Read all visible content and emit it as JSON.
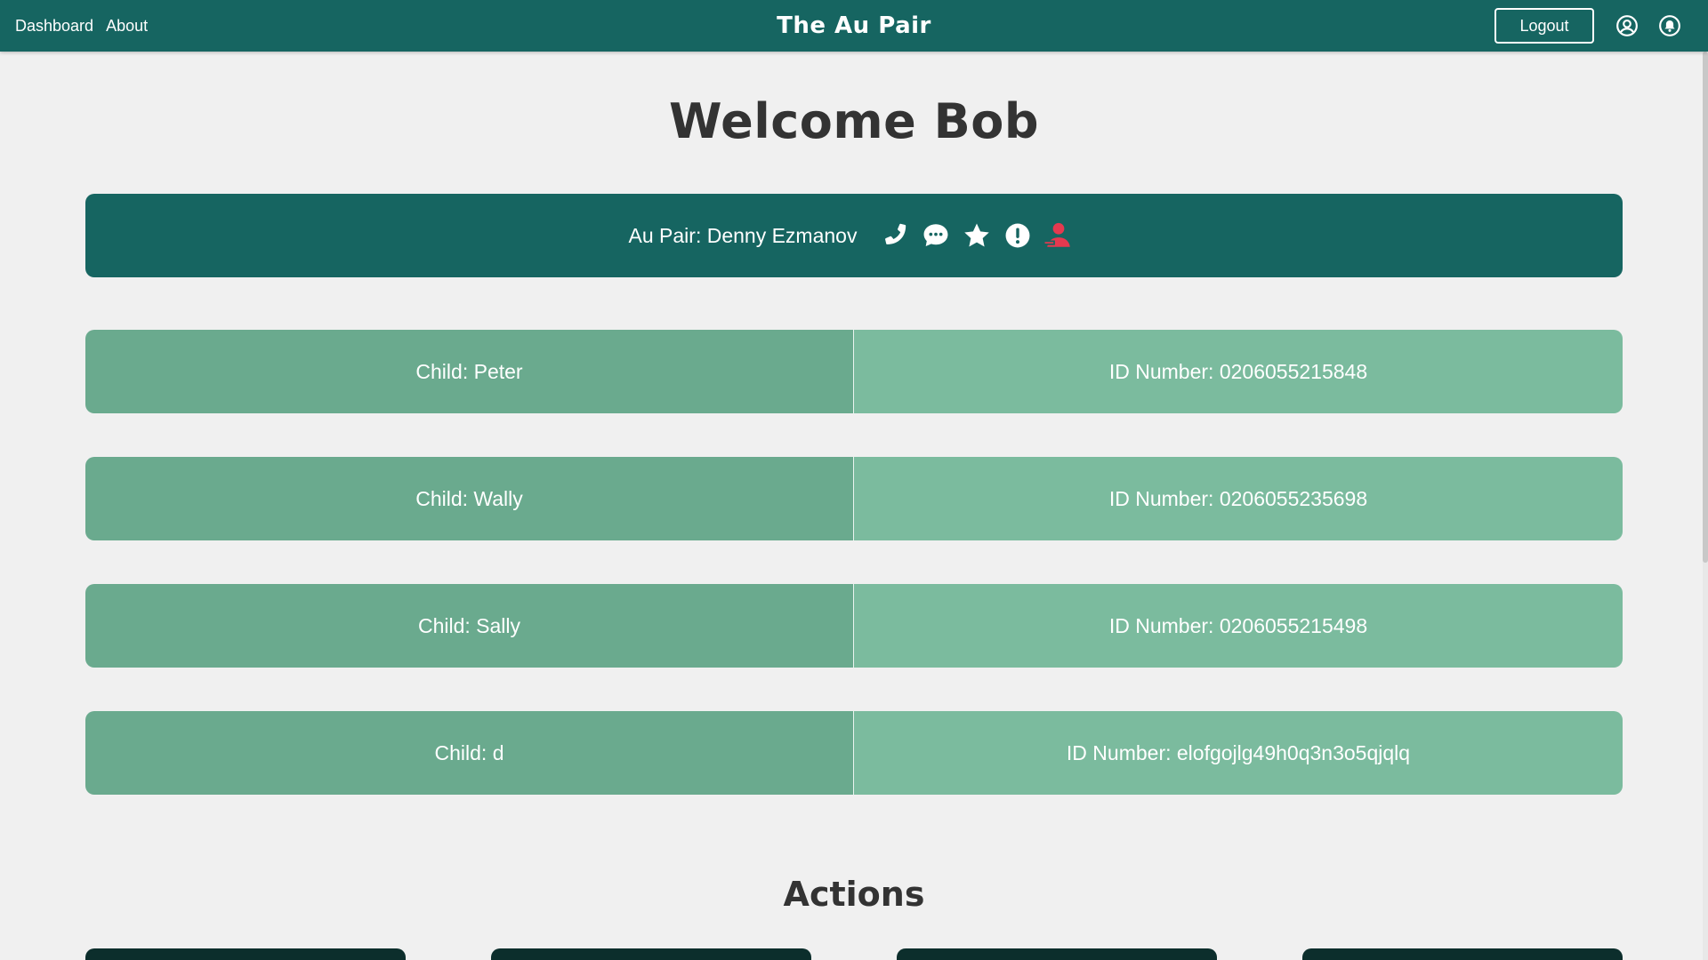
{
  "nav": {
    "links": [
      "Dashboard",
      "About"
    ],
    "brand": "The Au Pair",
    "logout_label": "Logout",
    "icons": [
      "account-circle-icon",
      "notification-bell-icon"
    ]
  },
  "welcome": "Welcome Bob",
  "aupair": {
    "label": "Au Pair: Denny Ezmanov",
    "icons": [
      "phone-icon",
      "chat-icon",
      "star-icon",
      "alert-icon",
      "remove-user-icon"
    ],
    "accent_remove": "#e5394f"
  },
  "children": [
    {
      "name": "Child: Peter",
      "id": "ID Number: 0206055215848"
    },
    {
      "name": "Child: Wally",
      "id": "ID Number: 0206055235698"
    },
    {
      "name": "Child: Sally",
      "id": "ID Number: 0206055215498"
    },
    {
      "name": "Child: d",
      "id": "ID Number: elofgojlg49h0q3n3o5qjqlq"
    }
  ],
  "actions_title": "Actions",
  "colors": {
    "primary": "#166561",
    "child_name_bg": "#6aaa8e",
    "child_id_bg": "#7bbb9e",
    "action_card": "#0c2e2c"
  }
}
